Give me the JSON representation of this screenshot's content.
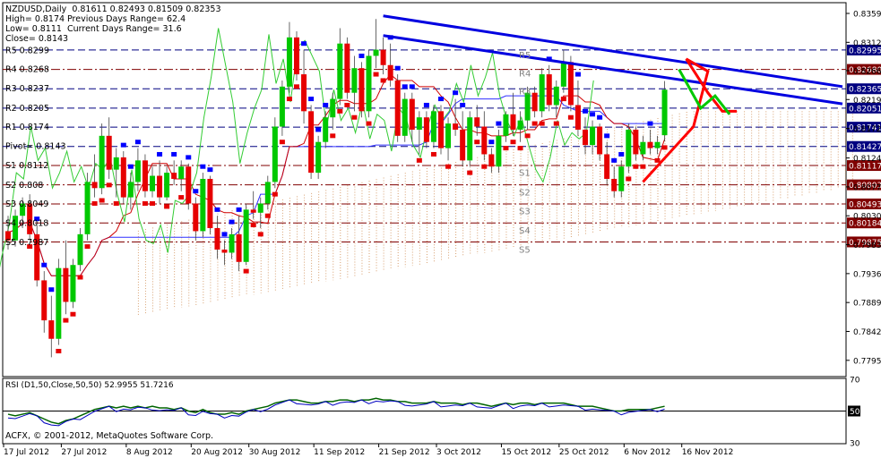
{
  "header": {
    "symbol_line": "NZDUSD,Daily  0.81611 0.82493 0.81509 0.82353",
    "high": "High= 0.8174",
    "low": "Low= 0.8111",
    "close": "Close= 0.8143",
    "prev_range": "Previous Days Range= 62.4",
    "curr_range": "Current Days Range= 31.6"
  },
  "pivot_labels": [
    {
      "label": "R5 0.8299",
      "value": 0.8299
    },
    {
      "label": "R4 0.8268",
      "value": 0.8268
    },
    {
      "label": "R3 0.8237",
      "value": 0.8237
    },
    {
      "label": "R2 0.8205",
      "value": 0.8205
    },
    {
      "label": "R1 0.8174",
      "value": 0.8174
    },
    {
      "label": "Pivot= 0.8143",
      "value": 0.8143
    },
    {
      "label": "S1 0.8112",
      "value": 0.8112
    },
    {
      "label": "S2 0.808",
      "value": 0.808
    },
    {
      "label": "S3 0.8049",
      "value": 0.8049
    },
    {
      "label": "S4 0.8018",
      "value": 0.8018
    },
    {
      "label": "S5 0.7987",
      "value": 0.7987
    }
  ],
  "level_lines": [
    {
      "value": 0.82995,
      "label": "0.82995",
      "color": "#000080",
      "style": "dashed",
      "badge_bg": "#000080"
    },
    {
      "value": 0.8268,
      "label": "0.82680",
      "color": "#800000",
      "style": "dashdot",
      "badge_bg": "#800000"
    },
    {
      "value": 0.82365,
      "label": "0.82365",
      "color": "#000080",
      "style": "dashed",
      "badge_bg": "#000080"
    },
    {
      "value": 0.82051,
      "label": "0.82051",
      "color": "#000080",
      "style": "dashed",
      "badge_bg": "#000080"
    },
    {
      "value": 0.81741,
      "label": "0.81741",
      "color": "#000080",
      "style": "dashed",
      "badge_bg": "#000080"
    },
    {
      "value": 0.81427,
      "label": "0.81427",
      "color": "#000080",
      "style": "dashed",
      "badge_bg": "#000080"
    },
    {
      "value": 0.81117,
      "label": "0.81117",
      "color": "#800000",
      "style": "dashdot",
      "badge_bg": "#800000"
    },
    {
      "value": 0.80803,
      "label": "0.80803",
      "color": "#800000",
      "style": "dashdot",
      "badge_bg": "#800000"
    },
    {
      "value": 0.80493,
      "label": "0.80493",
      "color": "#800000",
      "style": "dashdot",
      "badge_bg": "#800000"
    },
    {
      "value": 0.80184,
      "label": "0.80184",
      "color": "#800000",
      "style": "dashdot",
      "badge_bg": "#800000"
    },
    {
      "value": 0.79875,
      "label": "0.79875",
      "color": "#800000",
      "style": "dashdot",
      "badge_bg": "#800000"
    }
  ],
  "zone_labels": [
    {
      "text": "R5",
      "value": 0.8292
    },
    {
      "text": "R4",
      "value": 0.8262
    },
    {
      "text": "R3",
      "value": 0.8233
    },
    {
      "text": "S1",
      "value": 0.8101
    },
    {
      "text": "S2",
      "value": 0.8069
    },
    {
      "text": "S3",
      "value": 0.8038
    },
    {
      "text": "S4",
      "value": 0.8007
    },
    {
      "text": "S5",
      "value": 0.7976
    }
  ],
  "copyright": "ACFX, © 2001-2012, MetaQuotes Software Corp.",
  "rsi": {
    "label": "RSI (D1,50,Close,50,50) 52.9955 51.7216",
    "ticks": [
      "70",
      "50",
      "30"
    ],
    "level": 50
  },
  "colors": {
    "bull": "#00C800",
    "bear": "#E60000",
    "trendline": "#0000E0",
    "projection": "#FF0000",
    "projection_up": "#00C800",
    "cloud": "#D8A070",
    "kijun": "#3030FF",
    "tenkan": "#D00000",
    "chikou": "#33CC33"
  },
  "chart_data": {
    "type": "candlestick",
    "title": "NZDUSD,Daily",
    "ylim": [
      0.777,
      0.8375
    ],
    "y_ticks": [
      "0.83590",
      "0.83120",
      "0.82660",
      "0.82190",
      "0.81720",
      "0.81240",
      "0.80770",
      "0.80300",
      "0.79830",
      "0.79360",
      "0.78890",
      "0.78420",
      "0.77950"
    ],
    "x_ticks": [
      "17 Jul 2012",
      "27 Jul 2012",
      "8 Aug 2012",
      "20 Aug 2012",
      "30 Aug 2012",
      "11 Sep 2012",
      "21 Sep 2012",
      "3 Oct 2012",
      "15 Oct 2012",
      "25 Oct 2012",
      "6 Nov 2012",
      "16 Nov 2012"
    ],
    "x_tick_bar_index": [
      0,
      8,
      17,
      26,
      34,
      43,
      52,
      60,
      69,
      77,
      86,
      94
    ],
    "candles": [
      [
        0.8005,
        0.803,
        0.7975,
        0.799
      ],
      [
        0.799,
        0.804,
        0.798,
        0.803
      ],
      [
        0.803,
        0.806,
        0.801,
        0.805
      ],
      [
        0.805,
        0.8065,
        0.799,
        0.8
      ],
      [
        0.8,
        0.8015,
        0.7915,
        0.7925
      ],
      [
        0.7925,
        0.794,
        0.784,
        0.786
      ],
      [
        0.786,
        0.79,
        0.78,
        0.783
      ],
      [
        0.783,
        0.796,
        0.782,
        0.7945
      ],
      [
        0.7945,
        0.799,
        0.787,
        0.789
      ],
      [
        0.789,
        0.796,
        0.788,
        0.795
      ],
      [
        0.795,
        0.801,
        0.794,
        0.8
      ],
      [
        0.8,
        0.81,
        0.799,
        0.8085
      ],
      [
        0.8085,
        0.813,
        0.806,
        0.8075
      ],
      [
        0.8075,
        0.818,
        0.8065,
        0.816
      ],
      [
        0.816,
        0.819,
        0.809,
        0.8105
      ],
      [
        0.8105,
        0.814,
        0.806,
        0.8125
      ],
      [
        0.8125,
        0.8135,
        0.805,
        0.806
      ],
      [
        0.806,
        0.81,
        0.804,
        0.8085
      ],
      [
        0.8085,
        0.814,
        0.807,
        0.812
      ],
      [
        0.812,
        0.813,
        0.806,
        0.807
      ],
      [
        0.807,
        0.811,
        0.806,
        0.8095
      ],
      [
        0.8095,
        0.812,
        0.805,
        0.806
      ],
      [
        0.806,
        0.811,
        0.8055,
        0.81
      ],
      [
        0.81,
        0.812,
        0.808,
        0.809
      ],
      [
        0.809,
        0.812,
        0.807,
        0.811
      ],
      [
        0.811,
        0.8115,
        0.804,
        0.805
      ],
      [
        0.805,
        0.806,
        0.799,
        0.8005
      ],
      [
        0.8005,
        0.81,
        0.7995,
        0.809
      ],
      [
        0.809,
        0.8095,
        0.8,
        0.801
      ],
      [
        0.801,
        0.803,
        0.796,
        0.7975
      ],
      [
        0.7975,
        0.799,
        0.795,
        0.797
      ],
      [
        0.797,
        0.801,
        0.796,
        0.8
      ],
      [
        0.8,
        0.803,
        0.794,
        0.7955
      ],
      [
        0.7955,
        0.805,
        0.795,
        0.804
      ],
      [
        0.804,
        0.807,
        0.8025,
        0.8035
      ],
      [
        0.8035,
        0.806,
        0.801,
        0.805
      ],
      [
        0.805,
        0.8095,
        0.804,
        0.8085
      ],
      [
        0.8085,
        0.819,
        0.8075,
        0.8175
      ],
      [
        0.8175,
        0.825,
        0.816,
        0.824
      ],
      [
        0.824,
        0.8345,
        0.823,
        0.832
      ],
      [
        0.832,
        0.833,
        0.825,
        0.826
      ],
      [
        0.826,
        0.83,
        0.818,
        0.82
      ],
      [
        0.82,
        0.821,
        0.809,
        0.81
      ],
      [
        0.81,
        0.816,
        0.809,
        0.815
      ],
      [
        0.815,
        0.82,
        0.814,
        0.819
      ],
      [
        0.819,
        0.823,
        0.817,
        0.822
      ],
      [
        0.822,
        0.8335,
        0.821,
        0.831
      ],
      [
        0.831,
        0.832,
        0.822,
        0.823
      ],
      [
        0.823,
        0.829,
        0.82,
        0.827
      ],
      [
        0.827,
        0.828,
        0.819,
        0.82
      ],
      [
        0.82,
        0.83,
        0.819,
        0.829
      ],
      [
        0.829,
        0.835,
        0.827,
        0.83
      ],
      [
        0.83,
        0.832,
        0.826,
        0.8275
      ],
      [
        0.8275,
        0.831,
        0.824,
        0.825
      ],
      [
        0.825,
        0.826,
        0.815,
        0.816
      ],
      [
        0.816,
        0.823,
        0.815,
        0.822
      ],
      [
        0.822,
        0.823,
        0.815,
        0.817
      ],
      [
        0.817,
        0.82,
        0.813,
        0.819
      ],
      [
        0.819,
        0.82,
        0.814,
        0.815
      ],
      [
        0.815,
        0.821,
        0.814,
        0.82
      ],
      [
        0.82,
        0.821,
        0.813,
        0.814
      ],
      [
        0.814,
        0.819,
        0.812,
        0.818
      ],
      [
        0.818,
        0.822,
        0.816,
        0.817
      ],
      [
        0.817,
        0.82,
        0.811,
        0.812
      ],
      [
        0.812,
        0.82,
        0.811,
        0.819
      ],
      [
        0.819,
        0.821,
        0.816,
        0.8175
      ],
      [
        0.8175,
        0.82,
        0.812,
        0.813
      ],
      [
        0.813,
        0.814,
        0.81,
        0.811
      ],
      [
        0.811,
        0.817,
        0.81,
        0.816
      ],
      [
        0.816,
        0.82,
        0.815,
        0.8195
      ],
      [
        0.8195,
        0.823,
        0.816,
        0.817
      ],
      [
        0.817,
        0.82,
        0.815,
        0.8185
      ],
      [
        0.8185,
        0.824,
        0.817,
        0.823
      ],
      [
        0.823,
        0.824,
        0.819,
        0.82
      ],
      [
        0.82,
        0.827,
        0.819,
        0.826
      ],
      [
        0.826,
        0.8275,
        0.82,
        0.821
      ],
      [
        0.821,
        0.825,
        0.819,
        0.824
      ],
      [
        0.824,
        0.83,
        0.823,
        0.828
      ],
      [
        0.828,
        0.829,
        0.82,
        0.821
      ],
      [
        0.821,
        0.825,
        0.816,
        0.817
      ],
      [
        0.817,
        0.819,
        0.813,
        0.8145
      ],
      [
        0.8145,
        0.8185,
        0.813,
        0.8175
      ],
      [
        0.8175,
        0.818,
        0.812,
        0.813
      ],
      [
        0.813,
        0.815,
        0.808,
        0.809
      ],
      [
        0.809,
        0.811,
        0.806,
        0.807
      ],
      [
        0.807,
        0.812,
        0.806,
        0.811
      ],
      [
        0.811,
        0.818,
        0.81,
        0.817
      ],
      [
        0.817,
        0.8175,
        0.812,
        0.813
      ],
      [
        0.813,
        0.816,
        0.812,
        0.815
      ],
      [
        0.815,
        0.817,
        0.813,
        0.814
      ],
      [
        0.814,
        0.816,
        0.813,
        0.815
      ],
      [
        0.8161,
        0.8249,
        0.8151,
        0.8235
      ]
    ],
    "trendlines": [
      {
        "from": [
          52,
          0.8355
        ],
        "to": [
          117,
          0.824
        ]
      },
      {
        "from": [
          52,
          0.8323
        ],
        "to": [
          117,
          0.8212
        ]
      }
    ],
    "projection_path": [
      [
        88,
        0.8085
      ],
      [
        95,
        0.8175
      ],
      [
        97,
        0.8265
      ],
      [
        94,
        0.8285
      ],
      [
        97,
        0.823
      ],
      [
        99,
        0.82
      ],
      [
        101,
        0.82
      ]
    ],
    "projection_down": [
      [
        93,
        0.8268
      ],
      [
        96,
        0.8205
      ],
      [
        98,
        0.8225
      ],
      [
        100,
        0.8195
      ]
    ],
    "rsi_values": [
      48,
      47,
      48,
      49,
      47,
      45,
      43,
      42,
      44,
      45,
      47,
      49,
      51,
      52,
      53,
      52,
      53,
      52,
      53,
      52,
      53,
      52,
      52,
      51,
      52,
      50,
      49,
      51,
      49,
      48,
      48,
      49,
      48,
      50,
      51,
      52,
      53,
      55,
      56,
      57,
      57,
      56,
      55,
      55,
      56,
      56,
      57,
      57,
      56,
      57,
      57,
      58,
      57,
      57,
      56,
      56,
      55,
      55,
      55,
      56,
      55,
      55,
      55,
      54,
      55,
      55,
      54,
      53,
      54,
      55,
      54,
      55,
      55,
      54,
      55,
      55,
      55,
      55,
      54,
      53,
      53,
      53,
      52,
      51,
      50,
      50,
      51,
      51,
      51,
      51,
      52,
      53
    ],
    "ylim_rsi": [
      30,
      70
    ]
  }
}
